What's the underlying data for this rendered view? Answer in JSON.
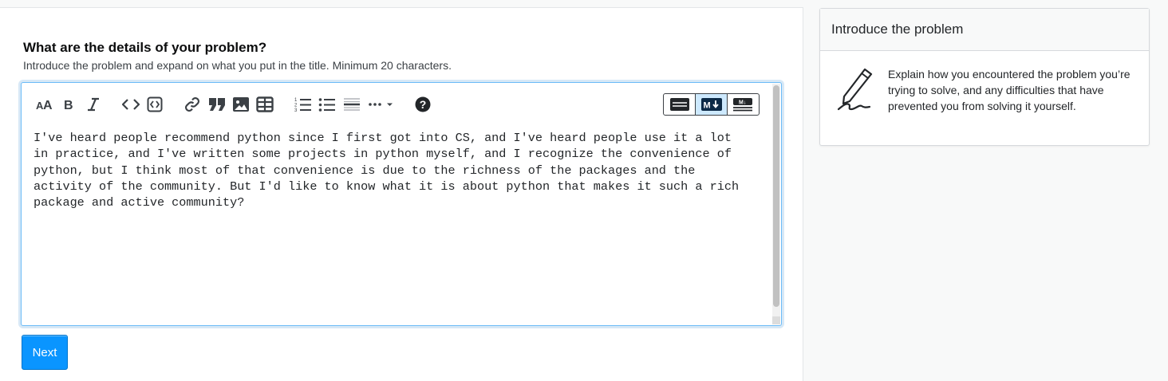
{
  "question": {
    "title": "What are the details of your problem?",
    "subtitle": "Introduce the problem and expand on what you put in the title. Minimum 20 characters."
  },
  "toolbar": {
    "buttons": [
      "heading-icon",
      "bold-icon",
      "italic-icon",
      "code-icon",
      "code-block-icon",
      "link-icon",
      "blockquote-icon",
      "image-icon",
      "table-icon",
      "ordered-list-icon",
      "unordered-list-icon",
      "horizontal-rule-icon",
      "more-icon",
      "help-icon"
    ],
    "modes": [
      "rich-text-mode-icon",
      "markdown-mode-icon",
      "markdown-preview-mode-icon"
    ],
    "active_mode": "markdown"
  },
  "editor": {
    "text": "I've heard people recommend python since I first got into CS, and I've heard people use it a lot\nin practice, and I've written some projects in python myself, and I recognize the convenience of\npython, but I think most of that convenience is due to the richness of the packages and the\nactivity of the community. But I'd like to know what it is about python that makes it such a rich\npackage and active community?"
  },
  "actions": {
    "next_label": "Next"
  },
  "help": {
    "title": "Introduce the problem",
    "body": "Explain how you encountered the problem you’re trying to solve, and any difficulties that have prevented you from solving it yourself.",
    "icon": "pencil-icon"
  },
  "colors": {
    "accent": "#0a95ff",
    "focus_border": "#6bbbf7",
    "active_mode_bg": "#cde9fe"
  }
}
